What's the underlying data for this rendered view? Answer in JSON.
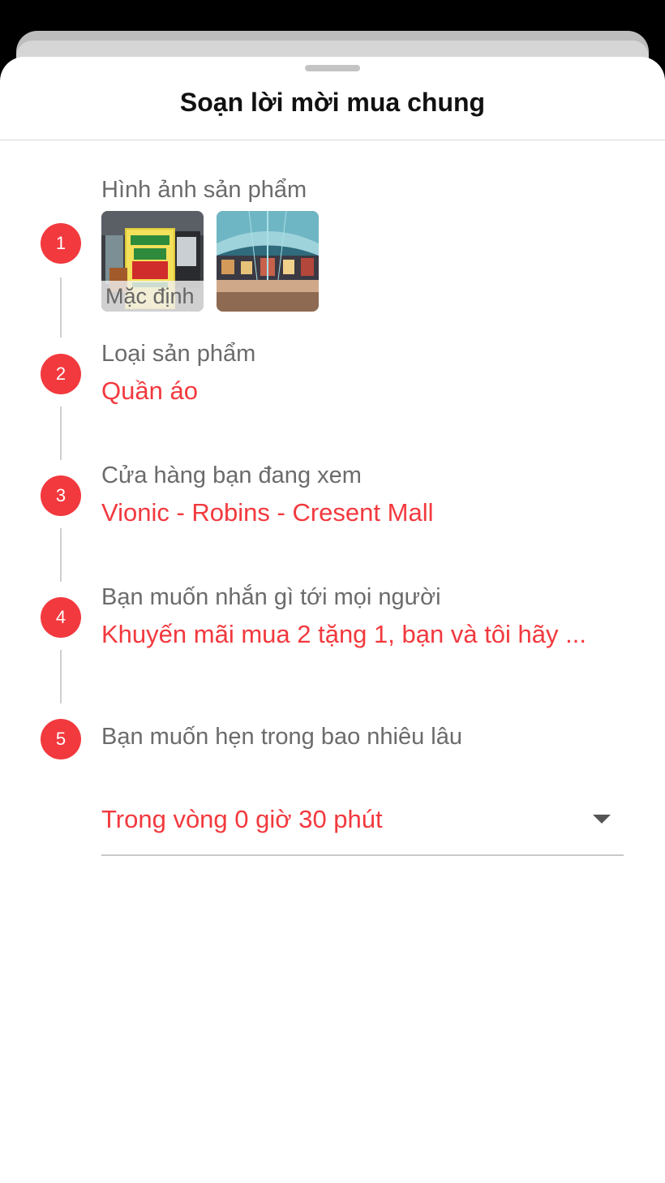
{
  "sheet": {
    "title": "Soạn lời mời mua chung"
  },
  "steps": [
    {
      "number": "1",
      "label": "Hình ảnh sản phẩm",
      "images": [
        {
          "caption": "Mặc định"
        },
        {
          "caption": ""
        }
      ]
    },
    {
      "number": "2",
      "label": "Loại sản phẩm",
      "value": "Quần áo"
    },
    {
      "number": "3",
      "label": "Cửa hàng bạn đang xem",
      "value": "Vionic - Robins - Cresent Mall"
    },
    {
      "number": "4",
      "label": "Bạn muốn nhắn gì tới mọi người",
      "value": "Khuyến mãi mua 2 tặng 1, bạn và tôi hãy ..."
    },
    {
      "number": "5",
      "label": "Bạn muốn hẹn trong bao nhiêu lâu",
      "value": "Trong vòng 0 giờ 30 phút"
    }
  ],
  "colors": {
    "accent": "#f2393e",
    "label_gray": "#6b6b6b"
  }
}
